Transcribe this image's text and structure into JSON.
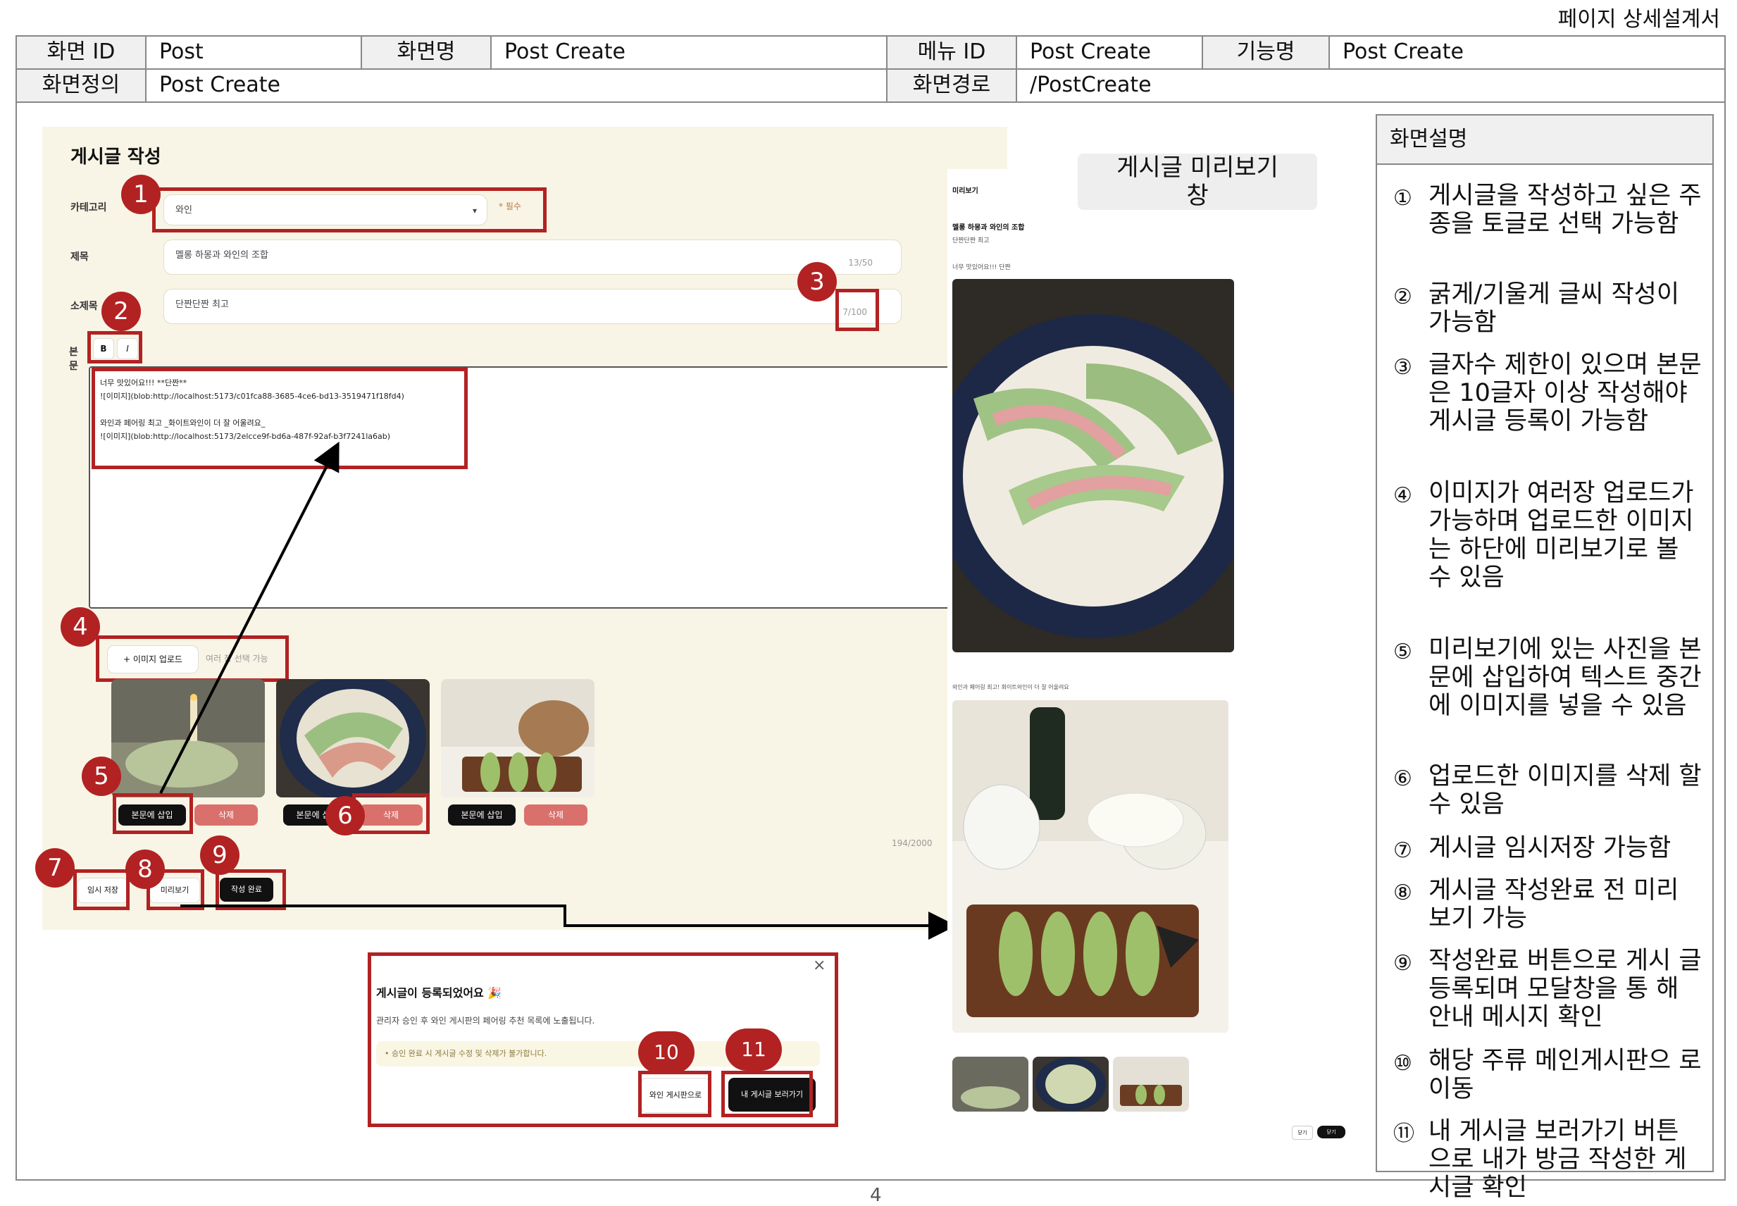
{
  "doc_title": "페이지 상세설계서",
  "header": {
    "screen_id_label": "화면 ID",
    "screen_id": "Post",
    "screen_name_label": "화면명",
    "screen_name": "Post Create",
    "menu_id_label": "메뉴 ID",
    "menu_id": "Post Create",
    "feature_label": "기능명",
    "feature": "Post Create",
    "definition_label": "화면정의",
    "definition": "Post Create",
    "path_label": "화면경로",
    "path": "/PostCreate"
  },
  "form": {
    "title": "게시글 작성",
    "category_label": "카테고리",
    "category_value": "와인",
    "required": "* 필수",
    "title_label": "제목",
    "title_value": "멜롱 하몽과 와인의 조합",
    "title_count": "13/50",
    "subtitle_label": "소제목",
    "subtitle_value": "단짠단짠 최고",
    "subtitle_count": "7/100",
    "body_label": "본문",
    "bold": "B",
    "italic": "I",
    "body_lines": [
      "너무 맛있어요!!! **단짠**",
      "![이미지](blob:http://localhost:5173/c01fca88-3685-4ce6-bd13-3519471f18fd4)",
      "",
      "와인과 페어링 최고 _화이트와인이 더 잘 어울려요_",
      "![이미지](blob:http://localhost:5173/2elcce9f-bd6a-487f-92af-b3f7241la6ab)"
    ],
    "upload_label": "+ 이미지 업로드",
    "upload_hint": "여러 장 선택 가능",
    "insert_label": "본문에 삽입",
    "delete_label": "삭제",
    "char_count": "194/2000",
    "temp_save": "임시 저장",
    "preview": "미리보기",
    "submit": "작성 완료"
  },
  "markers": [
    "1",
    "2",
    "3",
    "4",
    "5",
    "6",
    "7",
    "8",
    "9",
    "10",
    "11"
  ],
  "modal": {
    "title": "게시글이 등록되었어요 🎉",
    "message": "관리자 승인 후 와인 게시판의 페어링 추천 목록에 노출됩니다.",
    "notice": "• 승인 완료 시 게시글 수정 및 삭제가 불가합니다.",
    "btn_board": "와인 게시판으로",
    "btn_mypost": "내 게시글 보러가기",
    "close": "×"
  },
  "preview_panel": {
    "label": "게시글 미리보기 창",
    "header": "미리보기",
    "post_title": "멜롱 하몽과 와인의 조합",
    "post_sub": "단짠단짠 최고",
    "caption1": "너무 맛있어요!!! 단짠",
    "caption2": "와인과 페어링 최고! 화이트와인이 더 잘 어울려요",
    "btn_cancel": "닫기",
    "btn_close": "닫기"
  },
  "description": {
    "header": "화면설명",
    "items": [
      {
        "circle": "①",
        "text": "게시글을 작성하고 싶은 주종을 토글로 선택 가능함"
      },
      {
        "circle": "②",
        "text": "굵게/기울게 글씨 작성이 가능함"
      },
      {
        "circle": "③",
        "text": "글자수 제한이 있으며 본문은 10글자 이상 작성해야 게시글 등록이 가능함"
      },
      {
        "circle": "④",
        "text": "이미지가 여러장 업로드가 가능하며 업로드한 이미지는 하단에 미리보기로 볼 수 있음"
      },
      {
        "circle": "⑤",
        "text": "미리보기에 있는 사진을 본문에 삽입하여 텍스트 중간에 이미지를 넣을 수 있음"
      },
      {
        "circle": "⑥",
        "text": "업로드한 이미지를 삭제 할 수 있음"
      },
      {
        "circle": "⑦",
        "text": "게시글 임시저장 가능함"
      },
      {
        "circle": "⑧",
        "text": "게시글 작성완료 전 미리 보기 가능"
      },
      {
        "circle": "⑨",
        "text": "작성완료 버튼으로 게시 글 등록되며 모달창을 통 해 안내 메시지 확인"
      },
      {
        "circle": "⑩",
        "text": "해당 주류 메인게시판으 로 이동"
      },
      {
        "circle": "⑪",
        "text": "내 게시글 보러가기 버튼 으로 내가 방금 작성한 게 시글 확인"
      }
    ]
  },
  "page_number": "4"
}
